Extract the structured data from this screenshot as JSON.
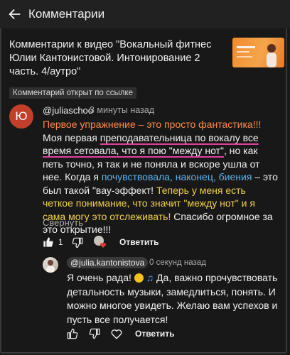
{
  "header": {
    "title": "Комментарии",
    "back_icon": "arrow-left-icon"
  },
  "video": {
    "title": "Комментарии к видео \"Вокальный фитнес Юлии Кантонистовой. Интонирование 2 часть. 4/аутро\""
  },
  "badge": "Комментарий открыт по ссылке",
  "comment": {
    "avatar_letter": "Ю",
    "username": "@juliaschoo",
    "time": "3 минуты назад",
    "parts": {
      "p1": "Первое упражнение – это просто фантастика!!!",
      "p2": " Моя первая ",
      "p3": "преподавательница по вокалу все время сетовала, что я пою \"между нот\"",
      "p4": ", но как петь точно, я так и не поняла и вскоре ушла от нее. Когда я ",
      "p5": "почувствовала, наконец, биения",
      "p6": " – это был такой \"вау-эффект! ",
      "p7": "Теперь у меня есть четкое понимание, что значит \"между нот\" и я сама могу это отслеживать!",
      "p8": " Спасибо огромное за это открытие!!!"
    },
    "collapse_label": "Свернуть",
    "like_count": "1",
    "reply_label": "Ответить"
  },
  "reply": {
    "username": "@julia.kantonistova",
    "time": "0 секунд назад",
    "text_a": "Я очень рада! ",
    "text_b": " Да, важно прочувствовать детальность музыки, замедлиться, понять. И можно многое увидеть. Желаю вам успехов и пусть все получается!",
    "reply_label": "Ответить"
  },
  "colors": {
    "background": "#181818",
    "header": "#212121",
    "orange_highlight": "#ff8a4c",
    "blue_highlight": "#5bb3f0",
    "yellow_highlight": "#f2d04a",
    "pink_underline": "#e040a0",
    "avatar": "#c2402a"
  }
}
